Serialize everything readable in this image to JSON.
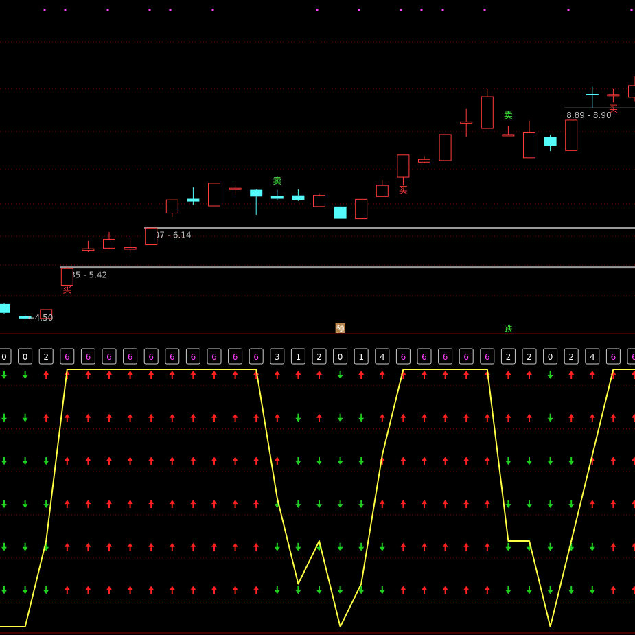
{
  "colors": {
    "background": "#000000",
    "grid": "#8b0000",
    "up_candle": "#ff3c3c",
    "down_candle": "#54fcfc",
    "level_line": "#9a9a9a",
    "level_text": "#c0c0c0",
    "buy_text": "#ff3c3c",
    "sell_text": "#3ddc3d",
    "score_text": "#ff40ff",
    "score_text_low": "#ffffff",
    "score_box": "#cfcfcf",
    "up_arrow": "#ff2020",
    "down_arrow": "#20d020",
    "score_line": "#ffff44",
    "top_dots": "#ff40ff",
    "yu_label_bg": "#b8844a",
    "yu_label_text": "#ffffff",
    "die_label_text": "#3ddc3d"
  },
  "chart_data": [
    {
      "type": "candlestick",
      "title": "",
      "ylim": [
        4.3,
        10.0
      ],
      "candles": [
        {
          "o": 4.76,
          "h": 4.78,
          "c": 4.6,
          "l": 4.58
        },
        {
          "o": 4.54,
          "h": 4.57,
          "c": 4.5,
          "l": 4.48
        },
        {
          "o": 4.5,
          "h": 4.66,
          "c": 4.66,
          "l": 4.5
        },
        {
          "o": 5.1,
          "h": 5.43,
          "c": 5.4,
          "l": 5.06
        },
        {
          "o": 5.73,
          "h": 5.9,
          "c": 5.76,
          "l": 5.7
        },
        {
          "o": 5.77,
          "h": 6.06,
          "c": 5.93,
          "l": 5.75
        },
        {
          "o": 5.75,
          "h": 5.96,
          "c": 5.78,
          "l": 5.68
        },
        {
          "o": 5.83,
          "h": 6.14,
          "c": 6.13,
          "l": 5.83
        },
        {
          "o": 6.4,
          "h": 6.64,
          "c": 6.64,
          "l": 6.33
        },
        {
          "o": 6.66,
          "h": 6.87,
          "c": 6.61,
          "l": 6.55
        },
        {
          "o": 6.53,
          "h": 6.94,
          "c": 6.94,
          "l": 6.53
        },
        {
          "o": 6.85,
          "h": 6.9,
          "c": 6.85,
          "l": 6.73
        },
        {
          "o": 6.82,
          "h": 6.84,
          "c": 6.7,
          "l": 6.37
        },
        {
          "o": 6.71,
          "h": 6.82,
          "c": 6.66,
          "l": 6.64
        },
        {
          "o": 6.72,
          "h": 6.83,
          "c": 6.64,
          "l": 6.62
        },
        {
          "o": 6.52,
          "h": 6.76,
          "c": 6.72,
          "l": 6.52
        },
        {
          "o": 6.52,
          "h": 6.55,
          "c": 6.3,
          "l": 6.3
        },
        {
          "o": 6.3,
          "h": 6.65,
          "c": 6.65,
          "l": 6.3
        },
        {
          "o": 6.7,
          "h": 7.0,
          "c": 6.9,
          "l": 6.7
        },
        {
          "o": 7.05,
          "h": 7.45,
          "c": 7.45,
          "l": 6.9
        },
        {
          "o": 7.32,
          "h": 7.43,
          "c": 7.37,
          "l": 7.3
        },
        {
          "o": 7.35,
          "h": 7.82,
          "c": 7.82,
          "l": 7.35
        },
        {
          "o": 8.05,
          "h": 8.28,
          "c": 8.05,
          "l": 7.78
        },
        {
          "o": 7.93,
          "h": 8.65,
          "c": 8.5,
          "l": 7.93
        },
        {
          "o": 7.82,
          "h": 7.97,
          "c": 7.82,
          "l": 7.82
        },
        {
          "o": 7.4,
          "h": 8.07,
          "c": 7.85,
          "l": 7.4
        },
        {
          "o": 7.77,
          "h": 7.82,
          "c": 7.62,
          "l": 7.52
        },
        {
          "o": 7.53,
          "h": 8.08,
          "c": 8.08,
          "l": 7.53
        },
        {
          "o": 8.55,
          "h": 8.68,
          "c": 8.53,
          "l": 8.3
        },
        {
          "o": 8.52,
          "h": 8.65,
          "c": 8.54,
          "l": 8.4
        },
        {
          "o": 8.49,
          "h": 8.87,
          "c": 8.7,
          "l": 8.42
        }
      ],
      "levels": [
        {
          "value": 5.42,
          "from": 3,
          "label": "5.35 - 5.42"
        },
        {
          "value": 6.14,
          "from": 7,
          "label": "6.07 - 6.14"
        },
        {
          "value": 8.3,
          "from": 27,
          "label": "8.89 - 8.90"
        }
      ],
      "annotations": [
        {
          "i": 1,
          "price": 4.46,
          "text": "←4.50",
          "kind": "level_text"
        },
        {
          "i": 3,
          "price": 4.96,
          "text": "买",
          "kind": "buy_text"
        },
        {
          "i": 13,
          "price": 6.93,
          "text": "卖",
          "kind": "sell_text"
        },
        {
          "i": 19,
          "price": 6.76,
          "text": "买",
          "kind": "buy_text"
        },
        {
          "i": 24,
          "price": 8.11,
          "text": "卖",
          "kind": "sell_text"
        },
        {
          "i": 29,
          "price": 8.23,
          "text": "买",
          "kind": "buy_text"
        }
      ],
      "signal_labels": [
        {
          "i": 16,
          "text": "预",
          "kind": "yu"
        },
        {
          "i": 24,
          "text": "跌",
          "kind": "die"
        }
      ]
    },
    {
      "type": "line",
      "title": "",
      "ylim": [
        0,
        6
      ],
      "x": [
        0,
        1,
        2,
        3,
        4,
        5,
        6,
        7,
        8,
        9,
        10,
        11,
        12,
        13,
        14,
        15,
        16,
        17,
        18,
        19,
        20,
        21,
        22,
        23,
        24,
        25,
        26,
        27,
        28,
        29,
        30
      ],
      "values": [
        0,
        0,
        2,
        6,
        6,
        6,
        6,
        6,
        6,
        6,
        6,
        6,
        6,
        3,
        1,
        2,
        0,
        1,
        4,
        6,
        6,
        6,
        6,
        6,
        2,
        2,
        0,
        2,
        4,
        6,
        6
      ],
      "score_labels": [
        "0",
        "0",
        "2",
        "6",
        "6",
        "6",
        "6",
        "6",
        "6",
        "6",
        "6",
        "6",
        "6",
        "3",
        "1",
        "2",
        "0",
        "1",
        "4",
        "6",
        "6",
        "6",
        "6",
        "6",
        "2",
        "2",
        "0",
        "2",
        "4",
        "6",
        "6"
      ],
      "arrow_rows": 6
    }
  ]
}
